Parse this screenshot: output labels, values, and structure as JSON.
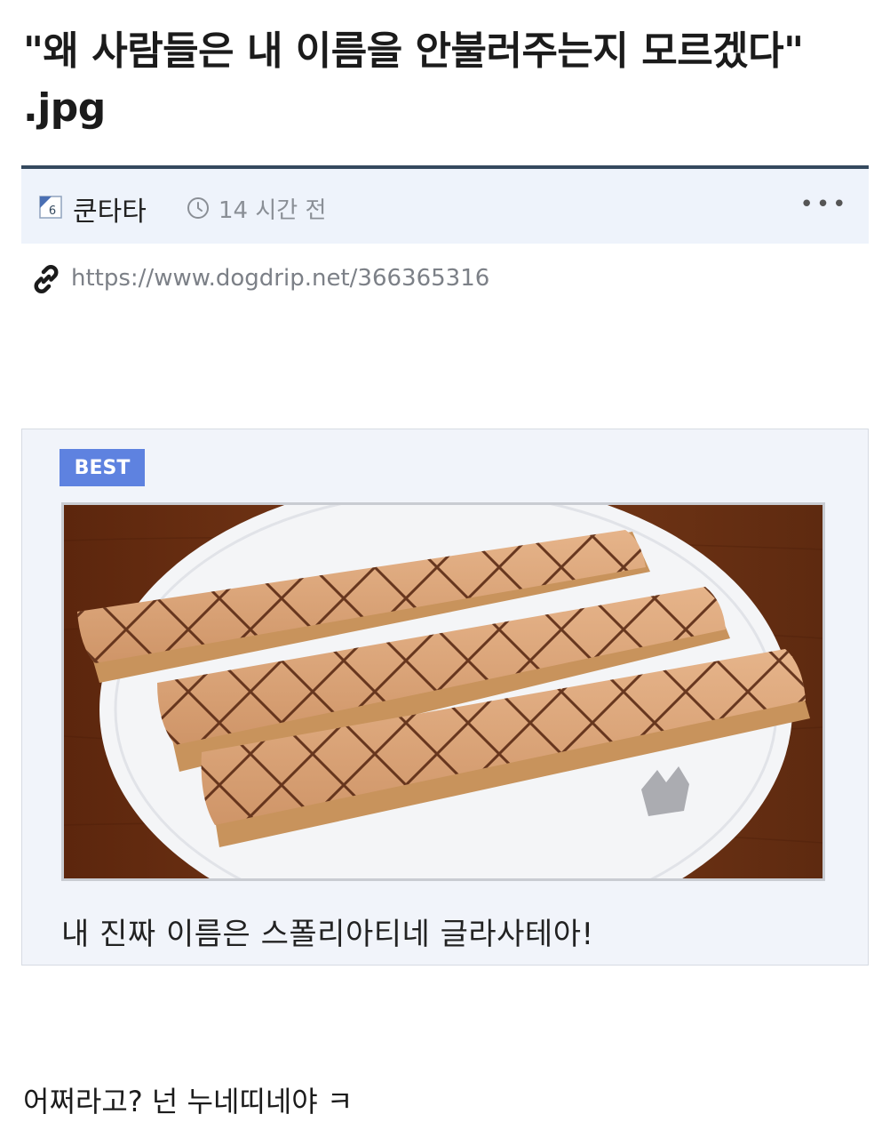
{
  "post": {
    "title": "\"왜 사람들은 내 이름을 안불러주는지 모르겠다\" .jpg",
    "author": "쿤타타",
    "level_badge": "6",
    "time": "14 시간 전",
    "more_label": "•••",
    "url": "https://www.dogdrip.net/366365316"
  },
  "card": {
    "badge": "BEST",
    "caption": "내 진짜 이름은 스폴리아티네 글라사테아!"
  },
  "comment": "어쩌라고? 넌 누네띠네야 ㅋ",
  "colors": {
    "meta_bg": "#eef3fb",
    "meta_border": "#34495e",
    "badge_blue": "#5e82e0",
    "wood": "#6e3214",
    "glaze": "#d9a57a"
  },
  "icons": {
    "level": "level-badge-icon",
    "clock": "clock-icon",
    "link": "link-icon",
    "more": "more-dots-icon"
  }
}
